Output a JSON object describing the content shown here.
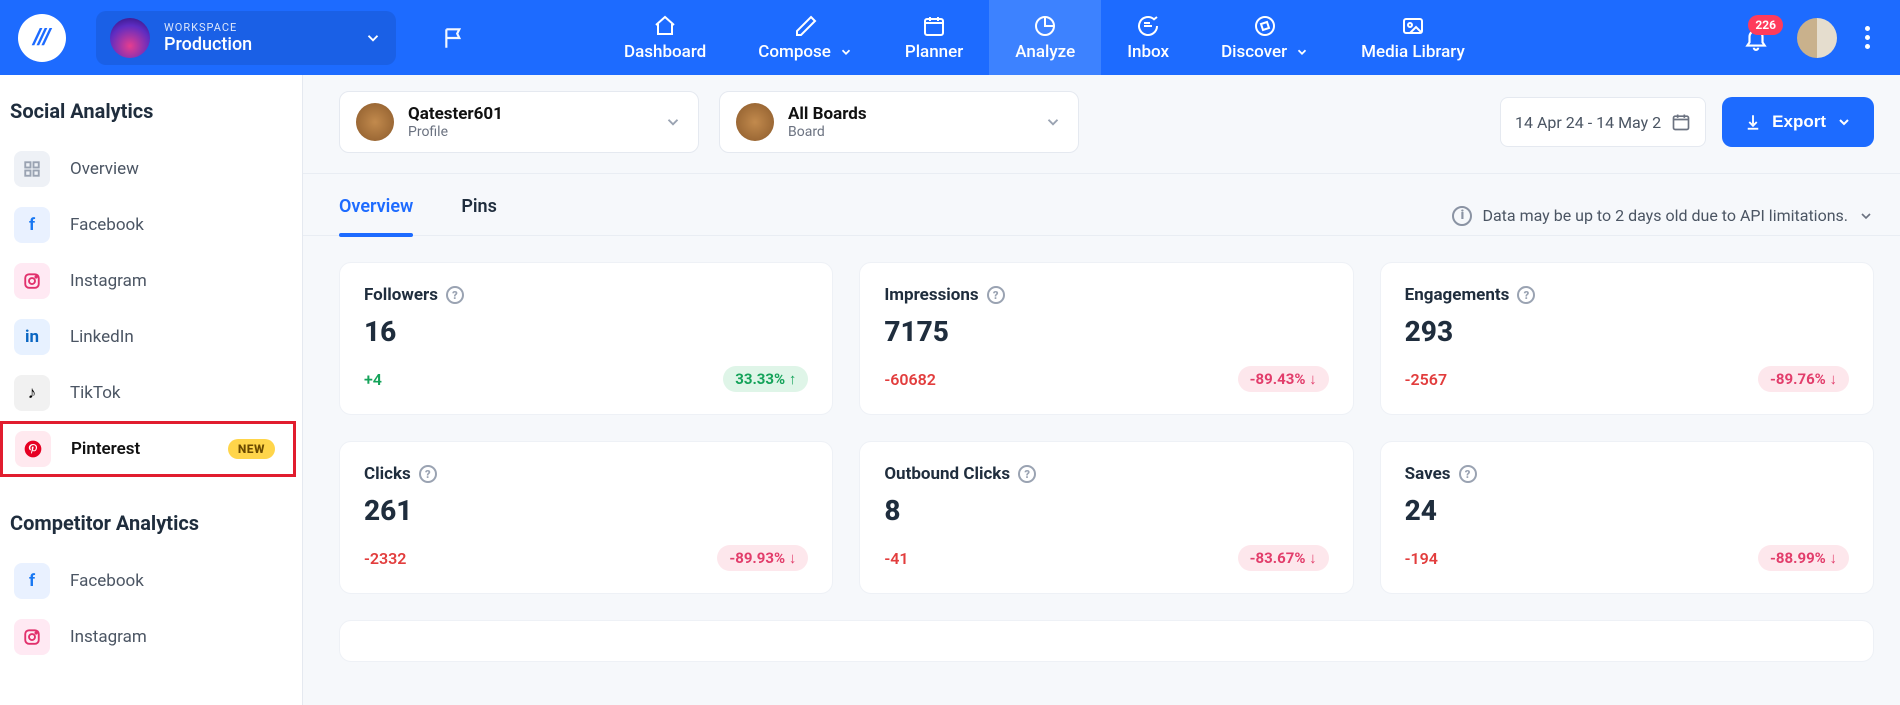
{
  "brand": {
    "glyph": "///"
  },
  "workspace": {
    "label": "WORKSPACE",
    "name": "Production"
  },
  "nav": {
    "dashboard": "Dashboard",
    "compose": "Compose",
    "planner": "Planner",
    "analyze": "Analyze",
    "inbox": "Inbox",
    "discover": "Discover",
    "media": "Media Library"
  },
  "notifications": {
    "count": "226"
  },
  "sidebar": {
    "section1": "Social Analytics",
    "section2": "Competitor Analytics",
    "items": {
      "overview": "Overview",
      "facebook": "Facebook",
      "instagram": "Instagram",
      "linkedin": "LinkedIn",
      "tiktok": "TikTok",
      "pinterest": "Pinterest",
      "new_badge": "NEW"
    },
    "comp": {
      "facebook": "Facebook",
      "instagram": "Instagram"
    }
  },
  "selectors": {
    "profile": {
      "name": "Qatester601",
      "sub": "Profile"
    },
    "board": {
      "name": "All Boards",
      "sub": "Board"
    },
    "daterange": "14 Apr 24 - 14 May 2",
    "export": "Export"
  },
  "tabs": {
    "overview": "Overview",
    "pins": "Pins"
  },
  "notice": "Data may be up to 2 days old due to API limitations.",
  "metrics": [
    {
      "title": "Followers",
      "value": "16",
      "delta": "+4",
      "delta_sign": "pos",
      "pct": "33.33% ↑",
      "pct_sign": "pos"
    },
    {
      "title": "Impressions",
      "value": "7175",
      "delta": "-60682",
      "delta_sign": "neg",
      "pct": "-89.43% ↓",
      "pct_sign": "neg"
    },
    {
      "title": "Engagements",
      "value": "293",
      "delta": "-2567",
      "delta_sign": "neg",
      "pct": "-89.76% ↓",
      "pct_sign": "neg"
    },
    {
      "title": "Clicks",
      "value": "261",
      "delta": "-2332",
      "delta_sign": "neg",
      "pct": "-89.93% ↓",
      "pct_sign": "neg"
    },
    {
      "title": "Outbound Clicks",
      "value": "8",
      "delta": "-41",
      "delta_sign": "neg",
      "pct": "-83.67% ↓",
      "pct_sign": "neg"
    },
    {
      "title": "Saves",
      "value": "24",
      "delta": "-194",
      "delta_sign": "neg",
      "pct": "-88.99% ↓",
      "pct_sign": "neg"
    }
  ]
}
